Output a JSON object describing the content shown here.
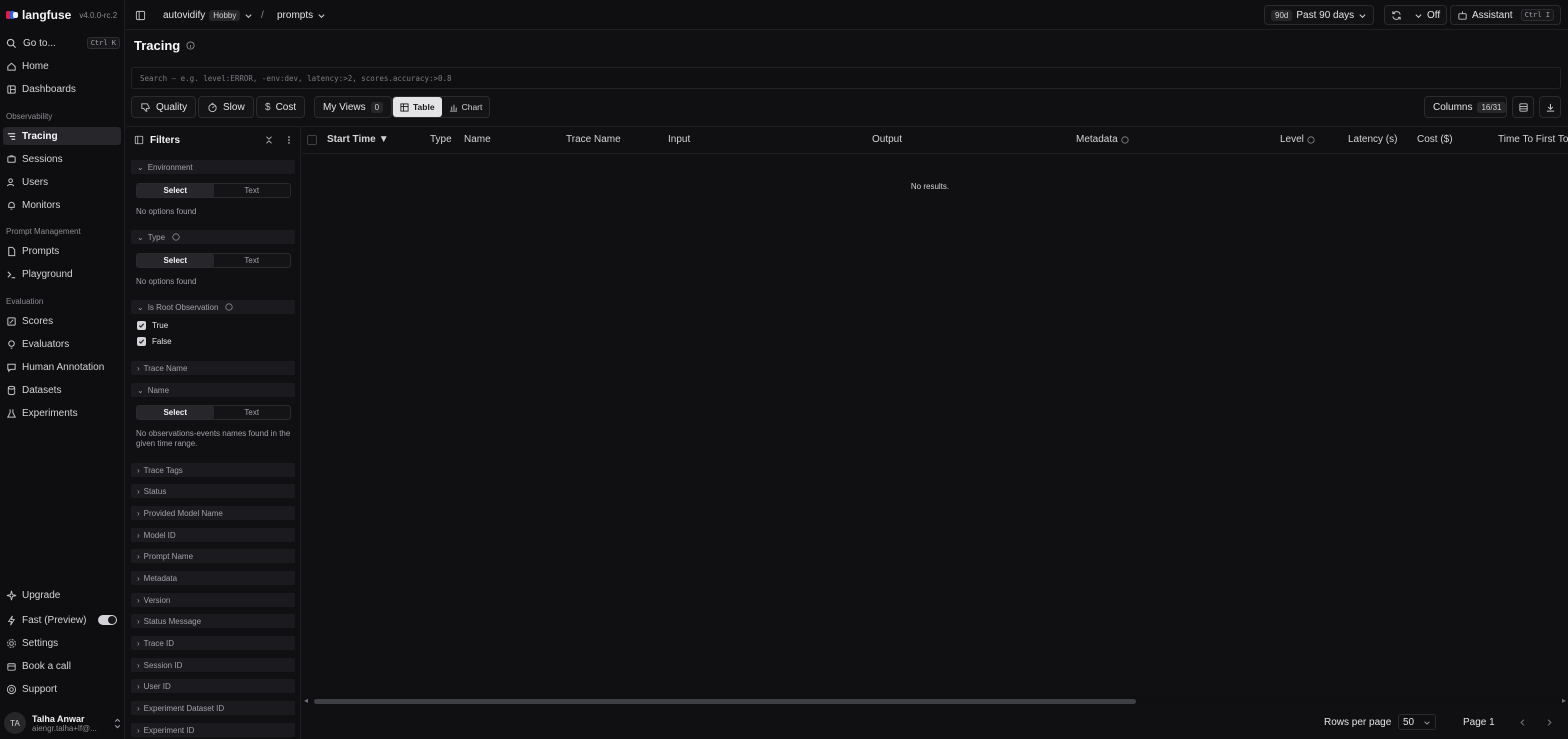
{
  "brand": {
    "name": "langfuse",
    "version": "v4.0.0-rc.2"
  },
  "sidebar": {
    "goto": {
      "label": "Go to...",
      "shortcut": "Ctrl K"
    },
    "top_items": [
      {
        "label": "Home",
        "icon": "home-icon"
      },
      {
        "label": "Dashboards",
        "icon": "dashboard-icon"
      }
    ],
    "sections": [
      {
        "title": "Observability",
        "items": [
          {
            "label": "Tracing",
            "icon": "tracing-icon",
            "active": true
          },
          {
            "label": "Sessions",
            "icon": "sessions-icon"
          },
          {
            "label": "Users",
            "icon": "users-icon"
          },
          {
            "label": "Monitors",
            "icon": "bell-icon"
          }
        ]
      },
      {
        "title": "Prompt Management",
        "items": [
          {
            "label": "Prompts",
            "icon": "file-icon"
          },
          {
            "label": "Playground",
            "icon": "terminal-icon"
          }
        ]
      },
      {
        "title": "Evaluation",
        "items": [
          {
            "label": "Scores",
            "icon": "scores-icon"
          },
          {
            "label": "Evaluators",
            "icon": "lightbulb-icon"
          },
          {
            "label": "Human Annotation",
            "icon": "annotation-icon"
          },
          {
            "label": "Datasets",
            "icon": "database-icon"
          },
          {
            "label": "Experiments",
            "icon": "flask-icon"
          }
        ]
      }
    ],
    "bottom_items": [
      {
        "label": "Upgrade",
        "icon": "sparkle-icon"
      },
      {
        "label": "Fast (Preview)",
        "icon": "zap-icon",
        "toggle": true
      },
      {
        "label": "Settings",
        "icon": "gear-icon"
      },
      {
        "label": "Book a call",
        "icon": "calendar-icon"
      },
      {
        "label": "Support",
        "icon": "lifebuoy-icon"
      }
    ],
    "user": {
      "initials": "TA",
      "name": "Talha Anwar",
      "email": "aiengr.talha+lf@..."
    }
  },
  "topbar": {
    "project": "autovidify",
    "plan": "Hobby",
    "separator": "/",
    "page": "prompts",
    "range_badge": "90d",
    "range_label": "Past 90 days",
    "refresh": "Off",
    "assistant": "Assistant",
    "assistant_shortcut": "Ctrl I"
  },
  "page": {
    "title": "Tracing",
    "search_placeholder": "Search — e.g. level:ERROR, -env:dev, latency:>2, scores.accuracy:>0.8"
  },
  "toolbar": {
    "quality": "Quality",
    "slow": "Slow",
    "cost": "Cost",
    "my_views": "My Views",
    "my_views_count": "0",
    "table": "Table",
    "chart": "Chart",
    "columns": "Columns",
    "columns_count": "16/31"
  },
  "filters": {
    "title": "Filters",
    "environment": "Environment",
    "type": "Type",
    "is_root": "Is Root Observation",
    "select": "Select",
    "text": "Text",
    "no_options": "No options found",
    "true_label": "True",
    "false_label": "False",
    "trace_name": "Trace Name",
    "name": "Name",
    "no_names": "No observations-events names found in the given time range.",
    "collapsed": [
      "Trace Tags",
      "Status",
      "Provided Model Name",
      "Model ID",
      "Prompt Name",
      "Metadata",
      "Version",
      "Status Message",
      "Trace ID",
      "Session ID",
      "User ID",
      "Experiment Dataset ID",
      "Experiment ID"
    ]
  },
  "table": {
    "columns": [
      "Start Time",
      "Type",
      "Name",
      "Trace Name",
      "Input",
      "Output",
      "Metadata",
      "Level",
      "Latency (s)",
      "Cost ($)",
      "Time To First To"
    ],
    "empty": "No results.",
    "rows_per_page_label": "Rows per page",
    "rows_per_page": "50",
    "page": "Page 1"
  },
  "colors": {
    "background": "#101012",
    "sidebar": "#0e0e10",
    "active": "#26262b"
  }
}
